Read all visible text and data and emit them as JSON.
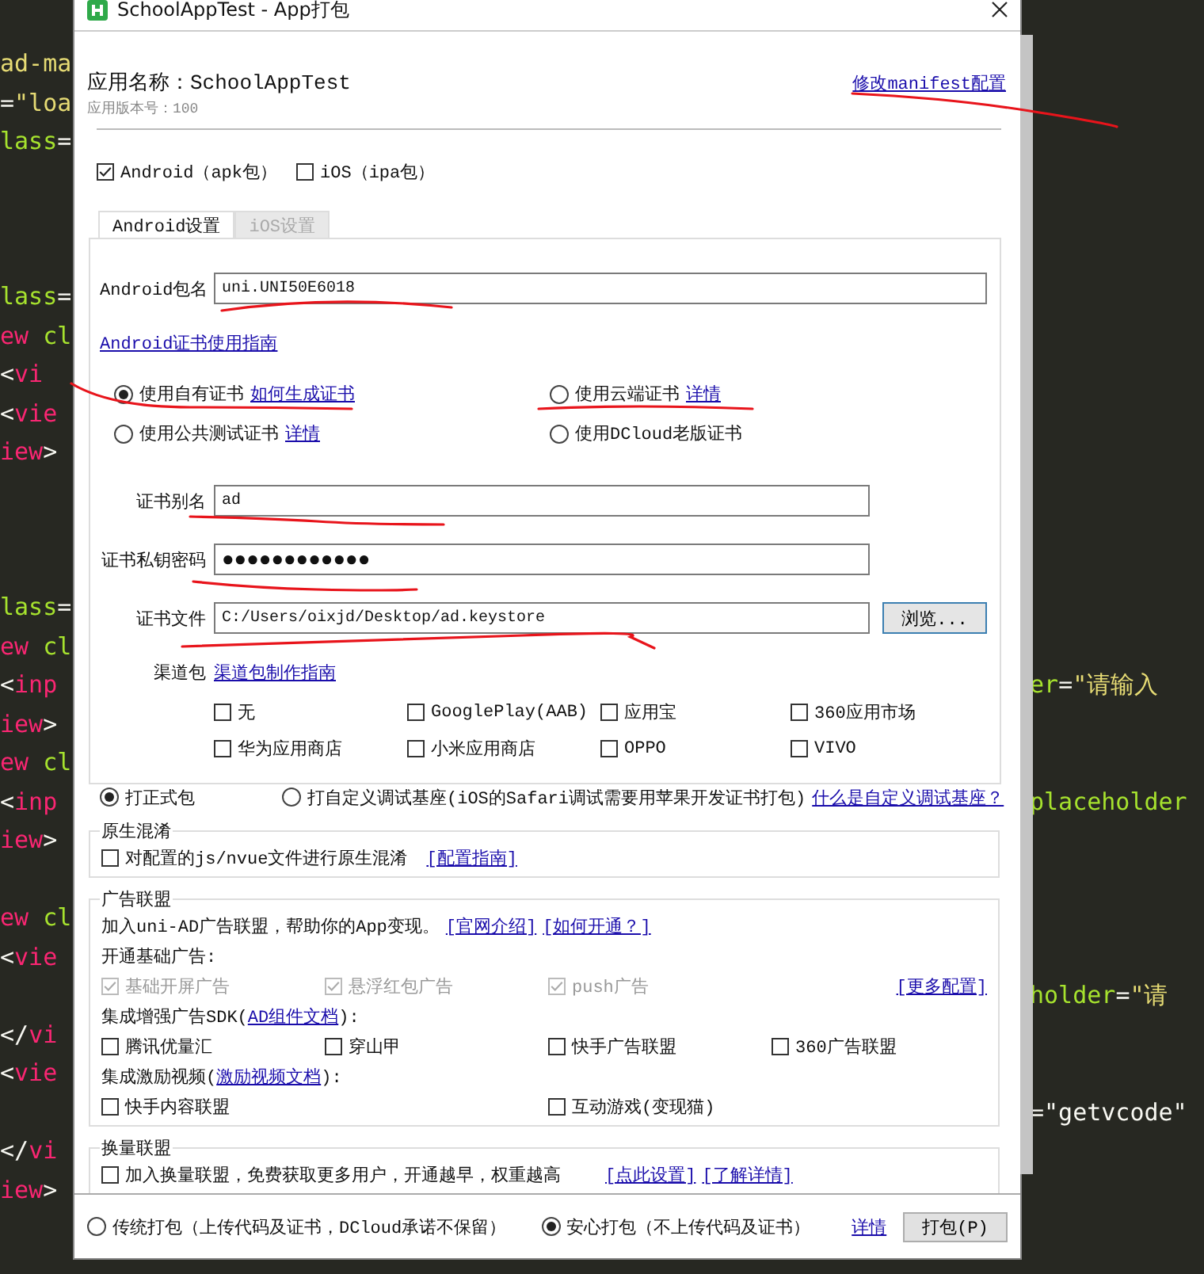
{
  "editor": {
    "lines": [
      {
        "kind": "code",
        "left": [
          {
            "text": "ad-ma",
            "color": "#e6db74"
          }
        ]
      },
      {
        "kind": "code",
        "left": [
          {
            "text": "=",
            "color": "#f8f8f2"
          },
          {
            "text": "\"loa",
            "color": "#e6db74"
          }
        ]
      },
      {
        "kind": "code",
        "left": [
          {
            "text": "lass",
            "color": "#a6e22e"
          },
          {
            "text": "=",
            "color": "#f8f8f2"
          }
        ]
      },
      {
        "kind": "blank"
      },
      {
        "kind": "blank"
      },
      {
        "kind": "blank"
      },
      {
        "kind": "code",
        "left": [
          {
            "text": "lass",
            "color": "#a6e22e"
          },
          {
            "text": "=",
            "color": "#f8f8f2"
          }
        ]
      },
      {
        "kind": "code",
        "left": [
          {
            "text": "ew",
            "color": "#f92672"
          },
          {
            "text": " cl",
            "color": "#a6e22e"
          }
        ]
      },
      {
        "kind": "code",
        "left": [
          {
            "text": "<",
            "color": "#f8f8f2"
          },
          {
            "text": "vi",
            "color": "#f92672"
          }
        ]
      },
      {
        "kind": "code",
        "left": [
          {
            "text": "<",
            "color": "#f8f8f2"
          },
          {
            "text": "vie",
            "color": "#f92672"
          }
        ]
      },
      {
        "kind": "code",
        "left": [
          {
            "text": "iew",
            "color": "#f92672"
          },
          {
            "text": ">",
            "color": "#f8f8f2"
          }
        ]
      },
      {
        "kind": "blank"
      },
      {
        "kind": "blank"
      },
      {
        "kind": "blank"
      },
      {
        "kind": "code",
        "left": [
          {
            "text": "lass",
            "color": "#a6e22e"
          },
          {
            "text": "=",
            "color": "#f8f8f2"
          }
        ]
      },
      {
        "kind": "code",
        "left": [
          {
            "text": "ew",
            "color": "#f92672"
          },
          {
            "text": " cl",
            "color": "#a6e22e"
          }
        ]
      },
      {
        "kind": "code",
        "left": [
          {
            "text": "<",
            "color": "#f8f8f2"
          },
          {
            "text": "inp",
            "color": "#f92672"
          }
        ],
        "right": [
          {
            "text": "er",
            "color": "#a6e22e"
          },
          {
            "text": "=",
            "color": "#f8f8f2"
          },
          {
            "text": "\"请输入",
            "color": "#e6db74"
          }
        ]
      },
      {
        "kind": "code",
        "left": [
          {
            "text": "iew",
            "color": "#f92672"
          },
          {
            "text": ">",
            "color": "#f8f8f2"
          }
        ]
      },
      {
        "kind": "code",
        "left": [
          {
            "text": "ew",
            "color": "#f92672"
          },
          {
            "text": " cl",
            "color": "#a6e22e"
          }
        ]
      },
      {
        "kind": "code",
        "left": [
          {
            "text": "<",
            "color": "#f8f8f2"
          },
          {
            "text": "inp",
            "color": "#f92672"
          }
        ],
        "right": [
          {
            "text": "placeholder",
            "color": "#a6e22e"
          }
        ]
      },
      {
        "kind": "code",
        "left": [
          {
            "text": "iew",
            "color": "#f92672"
          },
          {
            "text": ">",
            "color": "#f8f8f2"
          }
        ]
      },
      {
        "kind": "blank"
      },
      {
        "kind": "code",
        "left": [
          {
            "text": "ew",
            "color": "#f92672"
          },
          {
            "text": " cl",
            "color": "#a6e22e"
          }
        ]
      },
      {
        "kind": "code",
        "left": [
          {
            "text": "<",
            "color": "#f8f8f2"
          },
          {
            "text": "vie",
            "color": "#f92672"
          }
        ]
      },
      {
        "kind": "code",
        "right": [
          {
            "text": "holder",
            "color": "#a6e22e"
          },
          {
            "text": "=",
            "color": "#f8f8f2"
          },
          {
            "text": "\"请",
            "color": "#e6db74"
          }
        ]
      },
      {
        "kind": "code",
        "left": [
          {
            "text": "</",
            "color": "#f8f8f2"
          },
          {
            "text": "vi",
            "color": "#f92672"
          }
        ]
      },
      {
        "kind": "code",
        "left": [
          {
            "text": "<",
            "color": "#f8f8f2"
          },
          {
            "text": "vie",
            "color": "#f92672"
          }
        ]
      },
      {
        "kind": "code",
        "right": [
          {
            "text": "=",
            "color": "#f8f8f2"
          },
          {
            "text": "\"getvcode\"",
            "color": "#f8f8f2"
          }
        ]
      },
      {
        "kind": "code",
        "left": [
          {
            "text": "</",
            "color": "#f8f8f2"
          },
          {
            "text": "vi",
            "color": "#f92672"
          }
        ]
      },
      {
        "kind": "code",
        "left": [
          {
            "text": "iew",
            "color": "#f92672"
          },
          {
            "text": ">",
            "color": "#f8f8f2"
          }
        ]
      }
    ]
  },
  "dialog": {
    "title": "SchoolAppTest - App打包",
    "app_name": "应用名称：SchoolAppTest",
    "version": "应用版本号：100",
    "manifest_link": "修改manifest配置",
    "platforms": [
      {
        "label": "Android（apk包）",
        "checked": true
      },
      {
        "label": "iOS（ipa包）",
        "checked": false
      }
    ],
    "tabs": [
      {
        "label": "Android设置",
        "selected": true
      },
      {
        "label": "iOS设置",
        "selected": false
      }
    ],
    "package_name": {
      "label": "Android包名",
      "value": "uni.UNI50E6018"
    },
    "cert_guide_link": "Android证书使用指南",
    "cert_options": [
      {
        "label": "使用自有证书",
        "link": "如何生成证书",
        "selected": true
      },
      {
        "label": "使用云端证书",
        "link": "详情",
        "selected": false
      },
      {
        "label": "使用公共测试证书",
        "link": "详情",
        "selected": false
      },
      {
        "label": "使用DCloud老版证书",
        "selected": false
      }
    ],
    "cert_fields": [
      {
        "kind": "text",
        "label": "证书别名",
        "value": "ad"
      },
      {
        "kind": "password",
        "label": "证书私钥密码",
        "value": "●●●●●●●●●●●●"
      },
      {
        "kind": "file",
        "label": "证书文件",
        "value": "C:/Users/oixjd/Desktop/ad.keystore",
        "button": "浏览..."
      }
    ],
    "channels": {
      "label": "渠道包",
      "link": "渠道包制作指南",
      "options": [
        {
          "label": "无",
          "checked": false
        },
        {
          "label": "GooglePlay(AAB)",
          "checked": false
        },
        {
          "label": "应用宝",
          "checked": false
        },
        {
          "label": "360应用市场",
          "checked": false
        },
        {
          "label": "华为应用商店",
          "checked": false
        },
        {
          "label": "小米应用商店",
          "checked": false
        },
        {
          "label": "OPPO",
          "checked": false
        },
        {
          "label": "VIVO",
          "checked": false
        }
      ]
    },
    "build_types": [
      {
        "label": "打正式包",
        "selected": true
      },
      {
        "label": "打自定义调试基座(iOS的Safari调试需要用苹果开发证书打包)",
        "selected": false
      }
    ],
    "build_type_link": "什么是自定义调试基座？",
    "obfuscation": {
      "title": "原生混淆",
      "label": "对配置的js/nvue文件进行原生混淆",
      "checked": false,
      "links": [
        "[配置指南]"
      ]
    },
    "ads": {
      "title": "广告联盟",
      "intro": "加入uni-AD广告联盟，帮助你的App变现。",
      "intro_links": [
        "[官网介绍]",
        "[如何开通？]"
      ],
      "groups": [
        {
          "heading": "开通基础广告:",
          "options": [
            {
              "label": "基础开屏广告",
              "checked": true,
              "disabled": true
            },
            {
              "label": "悬浮红包广告",
              "checked": true,
              "disabled": true
            },
            {
              "label": "push广告",
              "checked": true,
              "disabled": true
            }
          ],
          "link": "[更多配置]"
        },
        {
          "heading": "集成增强广告SDK(",
          "heading_link": "AD组件文档",
          "heading_end": "):",
          "options": [
            {
              "label": "腾讯优量汇",
              "checked": false,
              "disabled": false
            },
            {
              "label": "穿山甲",
              "checked": false,
              "disabled": false
            },
            {
              "label": "快手广告联盟",
              "checked": false,
              "disabled": false
            },
            {
              "label": "360广告联盟",
              "checked": false,
              "disabled": false
            }
          ]
        },
        {
          "heading": "集成激励视频(",
          "heading_link": "激励视频文档",
          "heading_end": "):",
          "options": [
            {
              "label": "快手内容联盟",
              "checked": false,
              "disabled": false
            },
            {
              "label": "互动游戏(变现猫)",
              "checked": false,
              "disabled": false
            }
          ]
        }
      ]
    },
    "exchange": {
      "title": "换量联盟",
      "label": "加入换量联盟，免费获取更多用户，开通越早，权重越高",
      "checked": false,
      "links": [
        "[点此设置]",
        "[了解详情]"
      ]
    },
    "pack_modes": [
      {
        "label": "传统打包（上传代码及证书，DCloud承诺不保留）",
        "selected": false
      },
      {
        "label": "安心打包（不上传代码及证书）",
        "selected": true
      }
    ],
    "pack_mode_link": "详情",
    "pack_button": "打包(P)"
  }
}
